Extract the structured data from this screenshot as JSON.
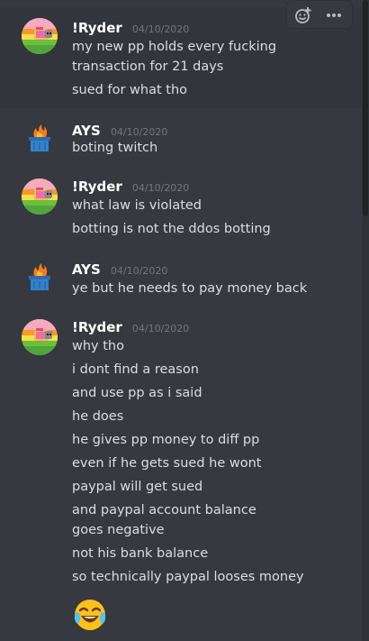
{
  "messages": [
    {
      "author": "!Ryder",
      "timestamp": "04/10/2020",
      "avatar_icon": "nyan-cat-rainbow",
      "lines": [
        "my new pp holds every fucking transaction for 21 days",
        "sued for what tho"
      ]
    },
    {
      "author": "AYS",
      "timestamp": "04/10/2020",
      "avatar_icon": "burning-dumpster",
      "lines": [
        "boting twitch"
      ]
    },
    {
      "author": "!Ryder",
      "timestamp": "04/10/2020",
      "avatar_icon": "nyan-cat-rainbow",
      "lines": [
        "what law is violated",
        "botting is not the ddos botting"
      ]
    },
    {
      "author": "AYS",
      "timestamp": "04/10/2020",
      "avatar_icon": "burning-dumpster",
      "lines": [
        "ye but he needs to pay money back"
      ]
    },
    {
      "author": "!Ryder",
      "timestamp": "04/10/2020",
      "avatar_icon": "nyan-cat-rainbow",
      "lines": [
        "why tho",
        "i dont find a reason",
        "and use pp as i said",
        "he does",
        "he gives pp money to diff pp",
        "even if he gets sued he wont",
        "paypal will get sued",
        "and paypal account balance goes negative",
        "not his bank balance",
        "so technically paypal looses money"
      ],
      "emoji": "crying-laughing-emoji"
    }
  ],
  "toolbar": {
    "icons": [
      "add-reaction-icon",
      "more-options-icon"
    ]
  },
  "colors": {
    "background": "#36393f",
    "hover_background": "#32353b",
    "author": "#ffffff",
    "timestamp": "#72767d",
    "text": "#dcddde"
  }
}
